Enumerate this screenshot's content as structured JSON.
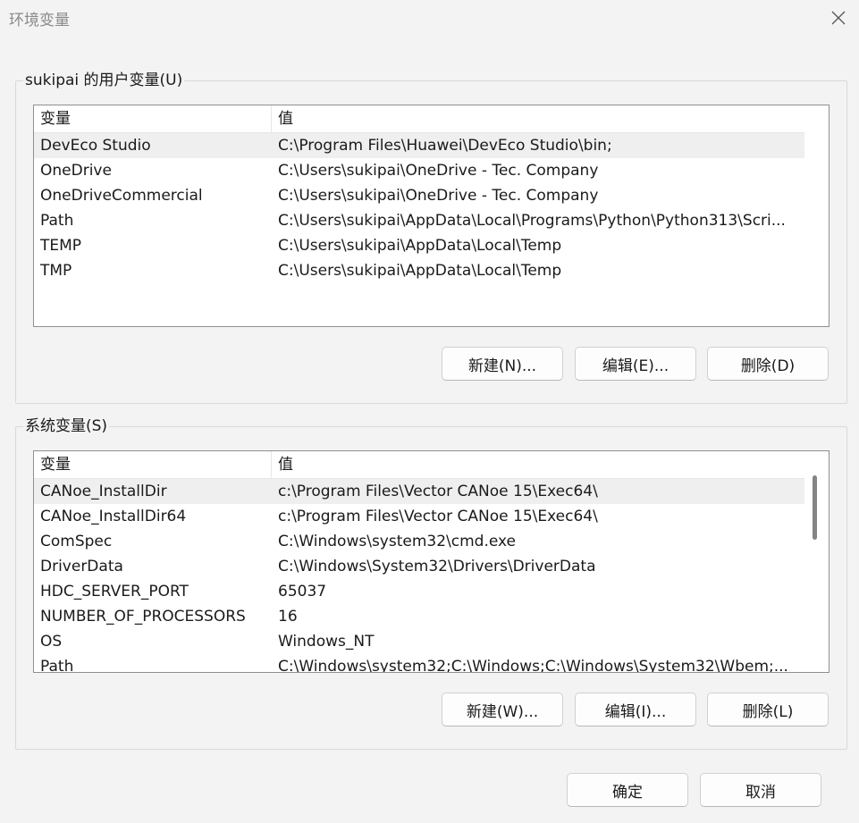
{
  "window": {
    "title": "环境变量",
    "close_icon": "close-icon"
  },
  "user_vars": {
    "group_label": "sukipai 的用户变量(U)",
    "columns": [
      "变量",
      "值"
    ],
    "rows": [
      {
        "name": "DevEco Studio",
        "value": "C:\\Program Files\\Huawei\\DevEco Studio\\bin;"
      },
      {
        "name": "OneDrive",
        "value": "C:\\Users\\sukipai\\OneDrive - Tec. Company"
      },
      {
        "name": "OneDriveCommercial",
        "value": "C:\\Users\\sukipai\\OneDrive - Tec. Company"
      },
      {
        "name": "Path",
        "value": "C:\\Users\\sukipai\\AppData\\Local\\Programs\\Python\\Python313\\Scri..."
      },
      {
        "name": "TEMP",
        "value": "C:\\Users\\sukipai\\AppData\\Local\\Temp"
      },
      {
        "name": "TMP",
        "value": "C:\\Users\\sukipai\\AppData\\Local\\Temp"
      }
    ],
    "selected_row": 0,
    "buttons": {
      "new": "新建(N)...",
      "edit": "编辑(E)...",
      "delete": "删除(D)"
    }
  },
  "system_vars": {
    "group_label": "系统变量(S)",
    "columns": [
      "变量",
      "值"
    ],
    "rows": [
      {
        "name": "CANoe_InstallDir",
        "value": "c:\\Program Files\\Vector CANoe 15\\Exec64\\"
      },
      {
        "name": "CANoe_InstallDir64",
        "value": "c:\\Program Files\\Vector CANoe 15\\Exec64\\"
      },
      {
        "name": "ComSpec",
        "value": "C:\\Windows\\system32\\cmd.exe"
      },
      {
        "name": "DriverData",
        "value": "C:\\Windows\\System32\\Drivers\\DriverData"
      },
      {
        "name": "HDC_SERVER_PORT",
        "value": "65037"
      },
      {
        "name": "NUMBER_OF_PROCESSORS",
        "value": "16"
      },
      {
        "name": "OS",
        "value": "Windows_NT"
      },
      {
        "name": "Path",
        "value": "C:\\Windows\\system32;C:\\Windows;C:\\Windows\\System32\\Wbem;..."
      }
    ],
    "selected_row": 0,
    "buttons": {
      "new": "新建(W)...",
      "edit": "编辑(I)...",
      "delete": "删除(L)"
    }
  },
  "footer": {
    "ok": "确定",
    "cancel": "取消"
  }
}
